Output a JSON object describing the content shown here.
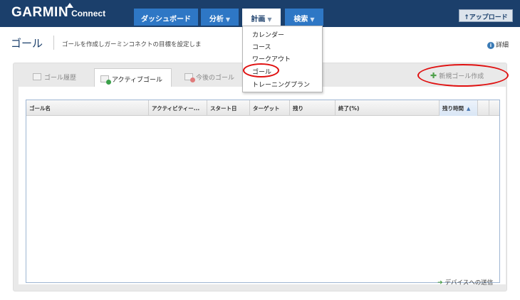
{
  "header": {
    "logo": "GARMIN",
    "logo_sub": "Connect",
    "nav": [
      {
        "label": "ダッシュボード",
        "caret": ""
      },
      {
        "label": "分析",
        "caret": "▼"
      },
      {
        "label": "計画",
        "caret": "▼"
      },
      {
        "label": "検索",
        "caret": "▼"
      }
    ],
    "upload_label": "↑アップロード"
  },
  "page": {
    "title": "ゴール",
    "description": "ゴールを作成しガーミンコネクトの目標を設定しま",
    "detail_label": "詳細"
  },
  "tabs": [
    {
      "label": "ゴール履歴"
    },
    {
      "label": "アクティブゴール"
    },
    {
      "label": "今後のゴール"
    }
  ],
  "new_goal_label": "新規ゴール作成",
  "table": {
    "columns": [
      "ゴール名",
      "アクティビティー...",
      "スタート日",
      "ターゲット",
      "残り",
      "終了(%)",
      "残り時間",
      "",
      ""
    ]
  },
  "send_to_device": "デバイスへの送信",
  "dropdown": {
    "items": [
      "カレンダー",
      "コース",
      "ワークアウト",
      "ゴール",
      "トレーニングプラン"
    ]
  },
  "colors": {
    "header_bg": "#1b3f6b",
    "nav_bg": "#2e77c5",
    "annotation_red": "#e01010"
  }
}
